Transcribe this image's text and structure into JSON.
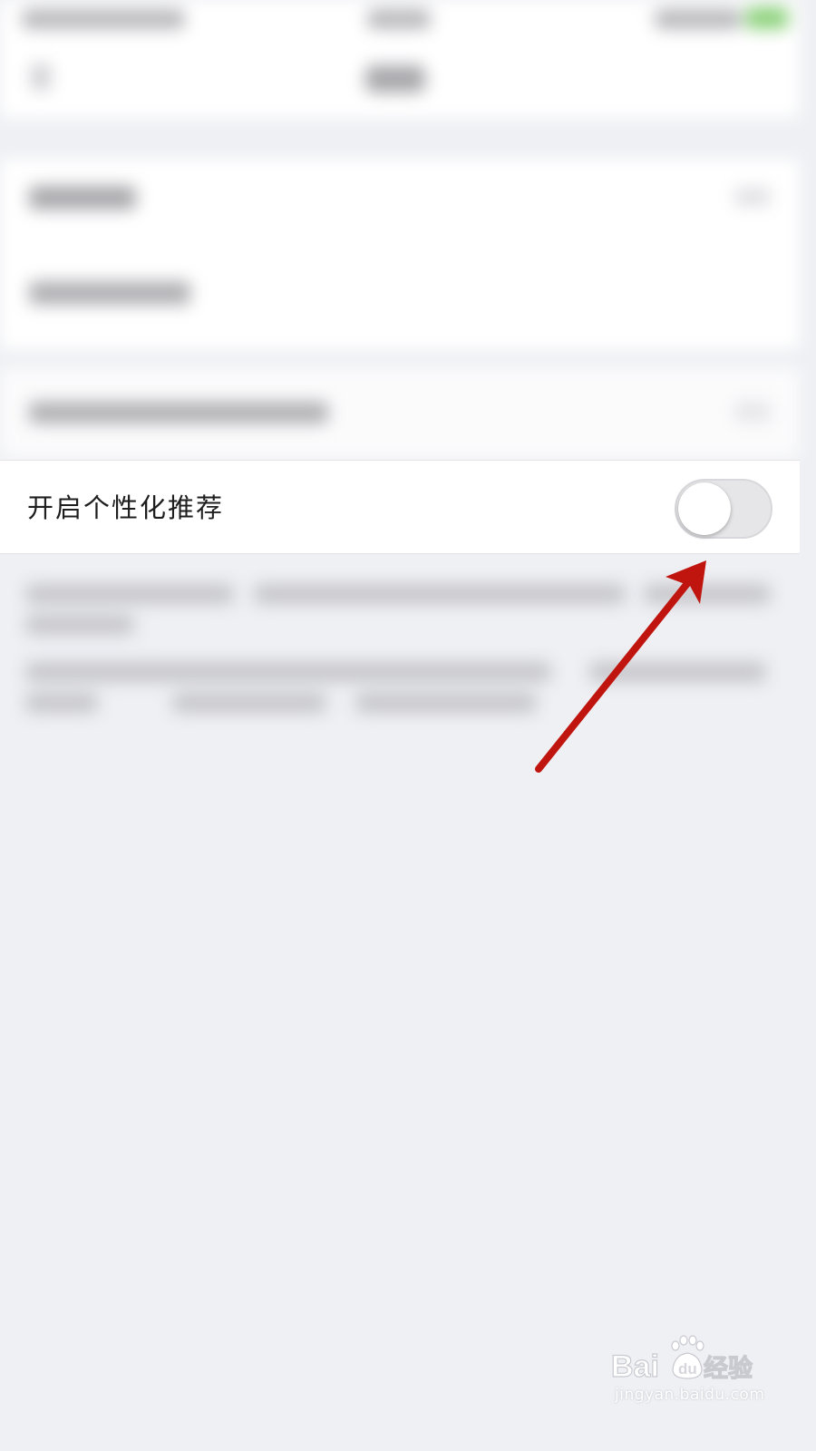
{
  "setting": {
    "label": "开启个性化推荐",
    "enabled": false
  },
  "watermark": {
    "logo_text": "Baidu经验",
    "url": "jingyan.baidu.com"
  },
  "colors": {
    "background": "#eff0f4",
    "row_background": "#ffffff",
    "switch_off_track": "#e6e6e8",
    "annotation_arrow": "#c0150e"
  },
  "icons": {
    "annotation": "arrow-pointing-at-toggle",
    "watermark": "baidu-paw-logo"
  }
}
